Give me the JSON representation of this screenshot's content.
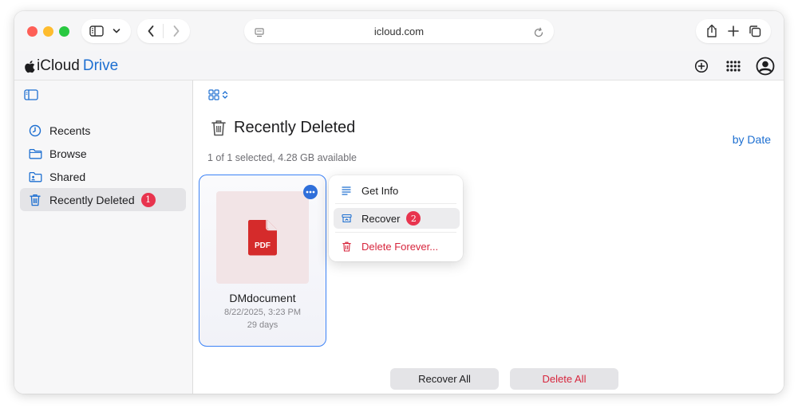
{
  "browser": {
    "address": "icloud.com"
  },
  "header": {
    "brand_prefix": "iCloud",
    "brand_suffix": "Drive"
  },
  "sidebar": {
    "items": [
      {
        "label": "Recents",
        "icon": "clock-icon"
      },
      {
        "label": "Browse",
        "icon": "folder-icon"
      },
      {
        "label": "Shared",
        "icon": "shared-folder-icon"
      },
      {
        "label": "Recently Deleted",
        "icon": "trash-icon",
        "badge": "1"
      }
    ]
  },
  "main": {
    "title": "Recently Deleted",
    "subtitle": "1 of 1 selected, 4.28 GB available",
    "sort_label": "by Date",
    "file": {
      "type_label": "PDF",
      "name": "DMdocument",
      "date": "8/22/2025, 3:23 PM",
      "days": "29 days"
    },
    "context_menu": {
      "get_info": "Get Info",
      "recover": "Recover",
      "recover_badge": "2",
      "delete_forever": "Delete Forever..."
    },
    "buttons": {
      "recover_all": "Recover All",
      "delete_all": "Delete All"
    }
  },
  "colors": {
    "accent": "#1d6fd1",
    "danger": "#d7263d",
    "badge": "#e8344e",
    "pdf_red": "#d52b2b"
  }
}
